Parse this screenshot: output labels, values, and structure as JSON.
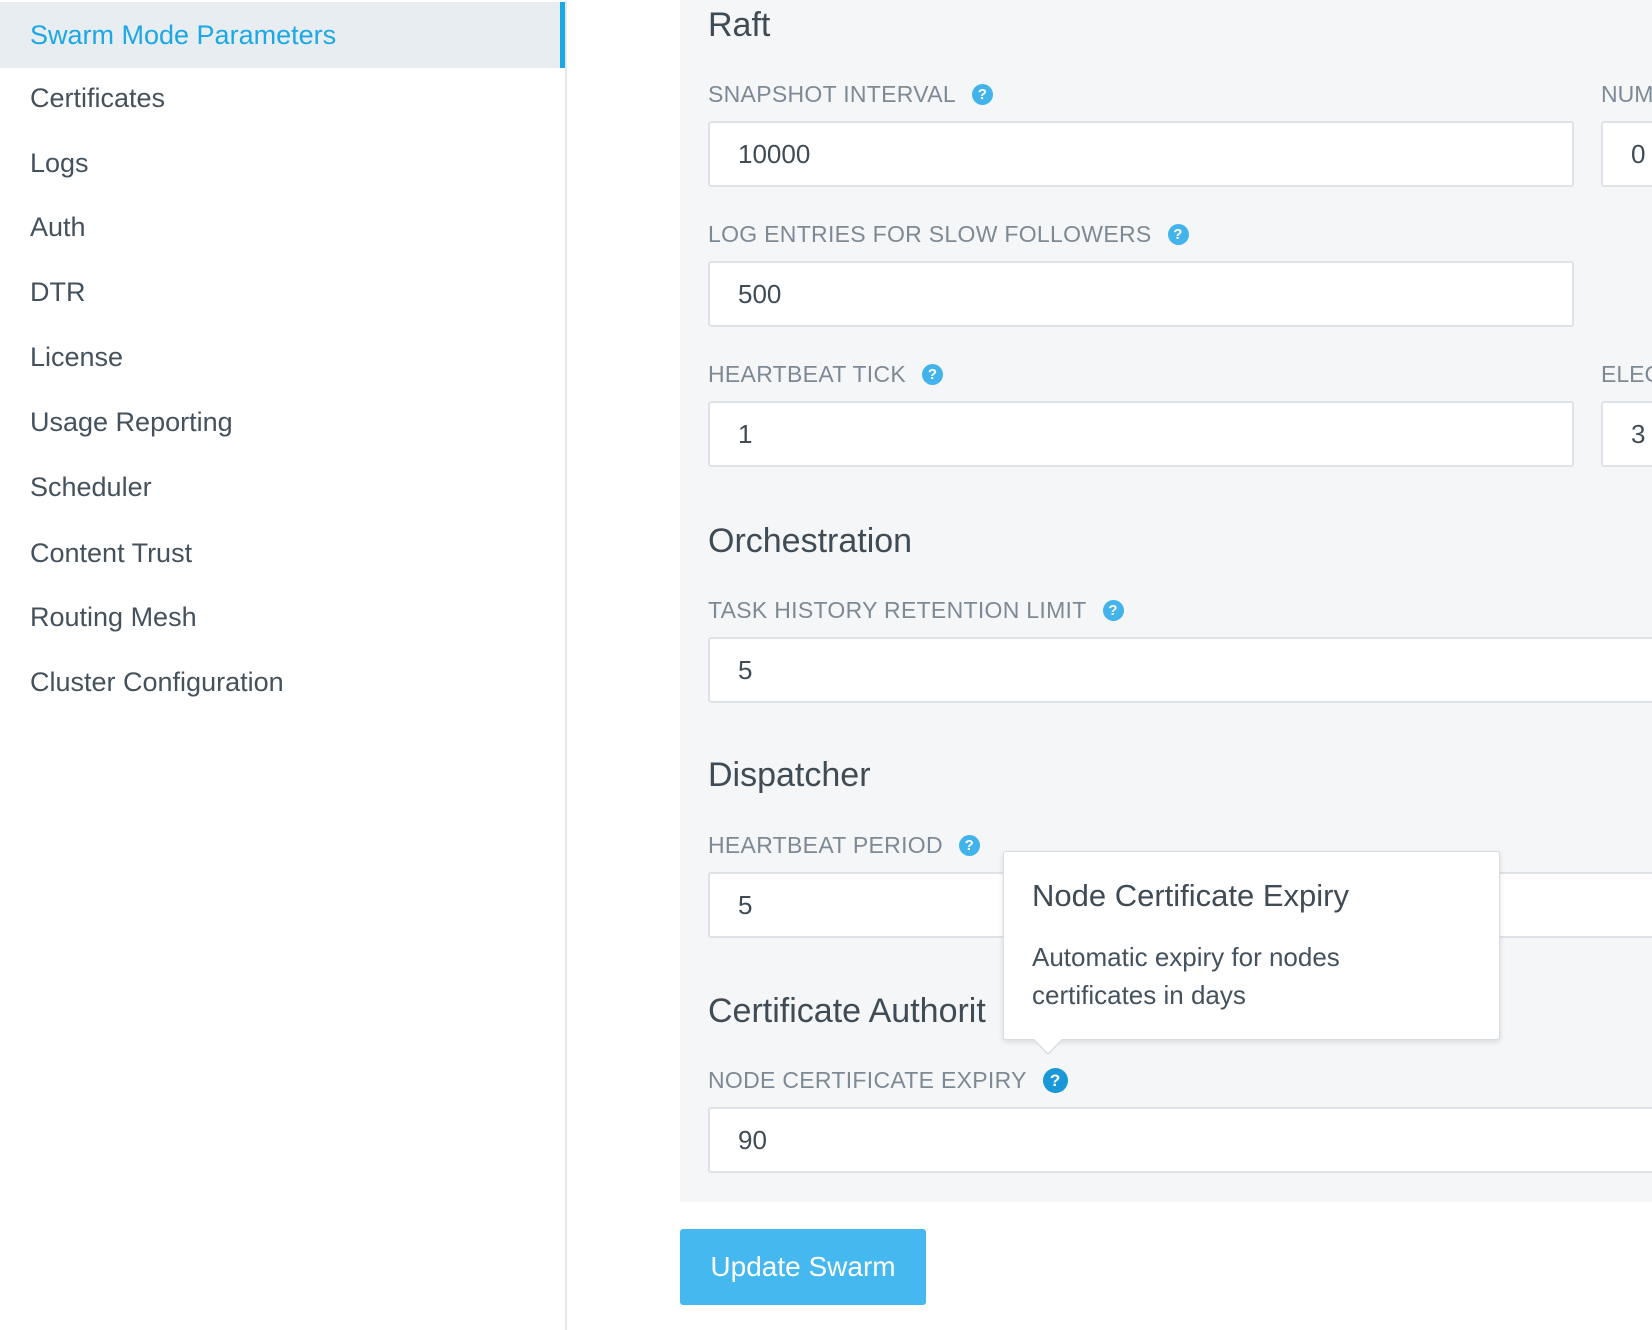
{
  "sidebar": {
    "items": [
      {
        "label": "Swarm Mode Parameters",
        "active": true
      },
      {
        "label": "Certificates"
      },
      {
        "label": "Logs"
      },
      {
        "label": "Auth"
      },
      {
        "label": "DTR"
      },
      {
        "label": "License"
      },
      {
        "label": "Usage Reporting"
      },
      {
        "label": "Scheduler"
      },
      {
        "label": "Content Trust"
      },
      {
        "label": "Routing Mesh"
      },
      {
        "label": "Cluster Configuration"
      }
    ]
  },
  "raft": {
    "title": "Raft",
    "snapshot_interval": {
      "label": "SNAPSHOT INTERVAL",
      "value": "10000"
    },
    "num_label_partial": "NUM",
    "num_value_partial": "0",
    "log_entries": {
      "label": "LOG ENTRIES FOR SLOW FOLLOWERS",
      "value": "500"
    },
    "heartbeat_tick": {
      "label": "HEARTBEAT TICK",
      "value": "1"
    },
    "elec_label_partial": "ELEC",
    "elec_value_partial": "3"
  },
  "orchestration": {
    "title": "Orchestration",
    "task_history": {
      "label": "TASK HISTORY RETENTION LIMIT",
      "value": "5"
    }
  },
  "dispatcher": {
    "title": "Dispatcher",
    "heartbeat_period": {
      "label": "HEARTBEAT PERIOD",
      "value": "5"
    }
  },
  "ca": {
    "title": "Certificate Authorit",
    "node_cert_expiry": {
      "label": "NODE CERTIFICATE EXPIRY",
      "value": "90"
    }
  },
  "tooltip": {
    "title": "Node Certificate Expiry",
    "body": "Automatic expiry for nodes certificates in days"
  },
  "help_glyph": "?",
  "actions": {
    "update_label": "Update Swarm"
  },
  "colors": {
    "accent": "#1ba8e6",
    "button": "#45b9ef",
    "panel_bg": "#f4f6f8"
  }
}
